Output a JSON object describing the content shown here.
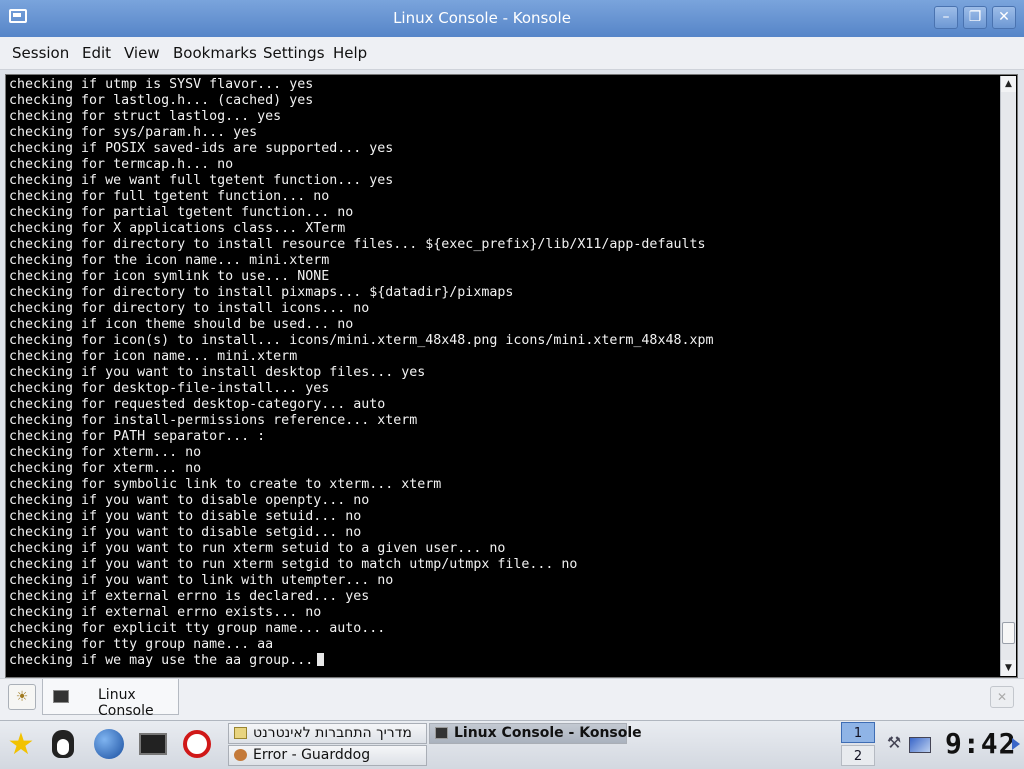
{
  "window": {
    "title": "Linux Console - Konsole",
    "controls": [
      "minimize",
      "maximize",
      "close"
    ]
  },
  "menu": [
    "Session",
    "Edit",
    "View",
    "Bookmarks",
    "Settings",
    "Help"
  ],
  "terminal": {
    "lines": [
      "checking if utmp is SYSV flavor... yes",
      "checking for lastlog.h... (cached) yes",
      "checking for struct lastlog... yes",
      "checking for sys/param.h... yes",
      "checking if POSIX saved-ids are supported... yes",
      "checking for termcap.h... no",
      "checking if we want full tgetent function... yes",
      "checking for full tgetent function... no",
      "checking for partial tgetent function... no",
      "checking for X applications class... XTerm",
      "checking for directory to install resource files... ${exec_prefix}/lib/X11/app-defaults",
      "checking for the icon name... mini.xterm",
      "checking for icon symlink to use... NONE",
      "checking for directory to install pixmaps... ${datadir}/pixmaps",
      "checking for directory to install icons... no",
      "checking if icon theme should be used... no",
      "checking for icon(s) to install... icons/mini.xterm_48x48.png icons/mini.xterm_48x48.xpm",
      "checking for icon name... mini.xterm",
      "checking if you want to install desktop files... yes",
      "checking for desktop-file-install... yes",
      "checking for requested desktop-category... auto",
      "checking for install-permissions reference... xterm",
      "checking for PATH separator... :",
      "checking for xterm... no",
      "checking for xterm... no",
      "checking for symbolic link to create to xterm... xterm",
      "checking if you want to disable openpty... no",
      "checking if you want to disable setuid... no",
      "checking if you want to disable setgid... no",
      "checking if you want to run xterm setuid to a given user... no",
      "checking if you want to run xterm setgid to match utmp/utmpx file... no",
      "checking if you want to link with utempter... no",
      "checking if external errno is declared... yes",
      "checking if external errno exists... no",
      "checking for explicit tty group name... auto...",
      "checking for tty group name... aa",
      "checking if we may use the aa group..."
    ]
  },
  "tabs": {
    "session_tab_label": "Linux Console"
  },
  "taskbar": {
    "tasks": {
      "hebrew": "מדריך התחברות לאינטרנט",
      "guarddog": "Error - Guarddog",
      "konsole": "Linux Console - Konsole"
    },
    "desktops": [
      "1",
      "2"
    ],
    "active_desktop": "1",
    "clock": "9:42"
  },
  "colors": {
    "titlebar": "#5685c8",
    "terminal_bg": "#000000",
    "terminal_fg": "#f2f2f2"
  }
}
